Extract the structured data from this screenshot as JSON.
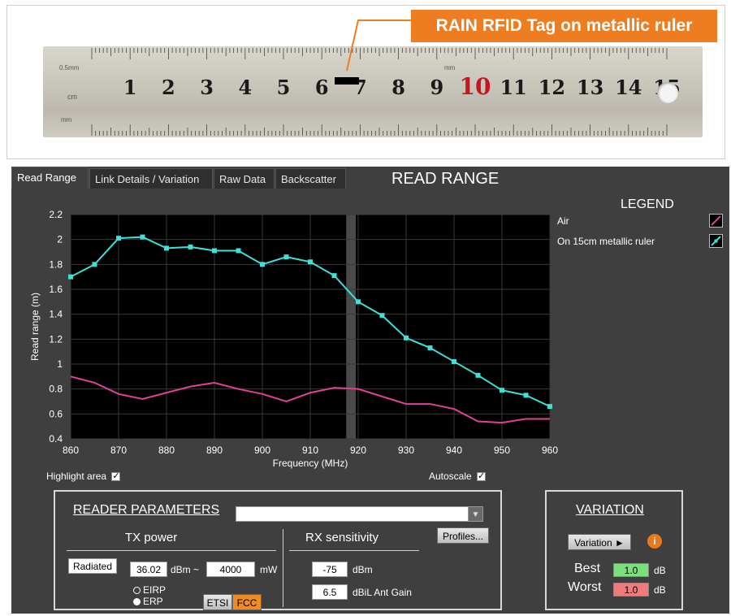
{
  "photo": {
    "callout": "RAIN RFID Tag on metallic ruler",
    "ruler_numbers": [
      "1",
      "2",
      "3",
      "4",
      "5",
      "6",
      "7",
      "8",
      "9",
      "10",
      "11",
      "12",
      "13",
      "14",
      "15"
    ],
    "ruler_unit_cm": "cm",
    "ruler_unit_mm": "mm",
    "ruler_fine_label": "0.5mm",
    "ruler_mm_label2": "mm",
    "highlight_number": "10"
  },
  "app": {
    "title": "READ RANGE",
    "tabs": [
      {
        "label": "Read Range",
        "active": true
      },
      {
        "label": "Link Details / Variation",
        "active": false
      },
      {
        "label": "Raw Data",
        "active": false
      },
      {
        "label": "Backscatter",
        "active": false
      }
    ],
    "legend": {
      "title": "LEGEND",
      "items": [
        {
          "label": "Air",
          "color": "#e0409a"
        },
        {
          "label": "On 15cm metallic ruler",
          "color": "#3fe0d6"
        }
      ]
    },
    "options": {
      "highlight_label": "Highlight area",
      "autoscale_label": "Autoscale"
    },
    "reader": {
      "title": "READER PARAMETERS",
      "profile_value": "",
      "profiles_button": "Profiles...",
      "tx_title": "TX power",
      "tx_mode": "Radiated",
      "tx_dbm": "36.02",
      "tx_dbm_unit": "dBm ~",
      "tx_mw": "4000",
      "tx_mw_unit": "mW",
      "eirp_label": "EIRP",
      "erp_label": "ERP",
      "erp_selected": true,
      "etsi_label": "ETSI",
      "fcc_label": "FCC",
      "rx_title": "RX sensitivity",
      "rx_dbm": "-75",
      "rx_dbm_unit": "dBm",
      "rx_gain": "6.5",
      "rx_gain_unit": "dBiL Ant Gain"
    },
    "variation": {
      "title": "VARIATION",
      "button": "Variation ►",
      "info_icon": "i",
      "best_label": "Best",
      "best_value": "1.0",
      "best_unit": "dB",
      "worst_label": "Worst",
      "worst_value": "1.0",
      "worst_unit": "dB",
      "best_color": "#7be07b",
      "worst_color": "#f07b7b"
    }
  },
  "chart_data": {
    "type": "line",
    "title": "",
    "xlabel": "Frequency (MHz)",
    "ylabel": "Read range (m)",
    "xlim": [
      860,
      960
    ],
    "ylim": [
      0.4,
      2.2
    ],
    "xticks": [
      860,
      870,
      880,
      890,
      900,
      910,
      920,
      930,
      940,
      950,
      960
    ],
    "yticks": [
      0.4,
      0.6,
      0.8,
      1,
      1.2,
      1.4,
      1.6,
      1.8,
      2,
      2.2
    ],
    "ytick_labels": [
      "0.4",
      "0.6",
      "0.8",
      "1",
      "1.2",
      "1.4",
      "1.6",
      "1.8",
      "2",
      "2.2"
    ],
    "grid": true,
    "highlight_band": [
      917.5,
      919.5
    ],
    "series": [
      {
        "name": "Air",
        "color": "#e0409a",
        "markers": false,
        "x": [
          860,
          865,
          870,
          875,
          880,
          885,
          890,
          895,
          900,
          905,
          910,
          915,
          920,
          925,
          930,
          935,
          940,
          945,
          950,
          955,
          960
        ],
        "y": [
          0.9,
          0.85,
          0.76,
          0.72,
          0.77,
          0.82,
          0.85,
          0.8,
          0.76,
          0.7,
          0.77,
          0.81,
          0.8,
          0.74,
          0.68,
          0.68,
          0.64,
          0.54,
          0.53,
          0.56,
          0.56
        ]
      },
      {
        "name": "On 15cm metallic ruler",
        "color": "#3fe0d6",
        "markers": true,
        "x": [
          860,
          865,
          870,
          875,
          880,
          885,
          890,
          895,
          900,
          905,
          910,
          915,
          920,
          925,
          930,
          935,
          940,
          945,
          950,
          955,
          960
        ],
        "y": [
          1.7,
          1.8,
          2.01,
          2.02,
          1.93,
          1.94,
          1.91,
          1.91,
          1.8,
          1.86,
          1.82,
          1.71,
          1.5,
          1.39,
          1.21,
          1.13,
          1.02,
          0.91,
          0.79,
          0.75,
          0.66
        ]
      }
    ]
  }
}
